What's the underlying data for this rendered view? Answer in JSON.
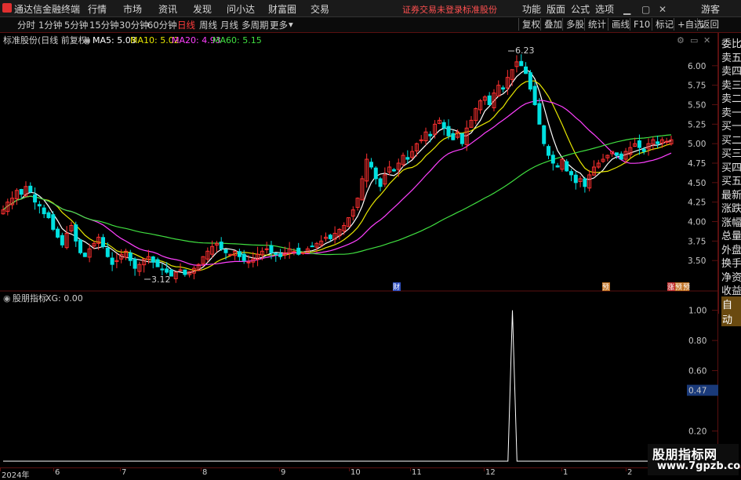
{
  "menubar": {
    "app_title": "通达信金融终端",
    "items": [
      "行情",
      "市场",
      "资讯",
      "发现",
      "问小达",
      "财富圈",
      "交易"
    ],
    "warning": "证券交易未登录",
    "stock_name": "标准股份",
    "right_items": [
      "功能",
      "版面",
      "公式",
      "选项"
    ],
    "user": "游客"
  },
  "toolbar": {
    "timeframes": [
      "分时",
      "1分钟",
      "5分钟",
      "15分钟",
      "30分钟",
      "60分钟",
      "日线",
      "周线",
      "月线",
      "多周期",
      "更多"
    ],
    "active": "日线",
    "right_buttons": [
      "复权",
      "叠加",
      "多股",
      "统计",
      "画线",
      "F10",
      "标记",
      "+自选",
      "返回"
    ]
  },
  "main_chart": {
    "title": "标准股份(日线 前复权)",
    "ma": [
      {
        "label": "MA5: 5.03",
        "color": "#ffffff"
      },
      {
        "label": "MA10: 5.02",
        "color": "#e6e600"
      },
      {
        "label": "MA20: 4.93",
        "color": "#ff40ff"
      },
      {
        "label": "MA60: 5.15",
        "color": "#40e040"
      }
    ],
    "y_ticks": [
      "6.00",
      "5.75",
      "5.50",
      "5.25",
      "5.00",
      "4.75",
      "4.50",
      "4.25",
      "4.00",
      "3.75",
      "3.50"
    ],
    "high_label": "6.23",
    "low_label": "3.12",
    "markers": [
      "财",
      "预",
      "涨",
      "预",
      "预"
    ]
  },
  "right_panel": [
    "委比",
    "卖五",
    "卖四",
    "卖三",
    "卖二",
    "卖一",
    "买一",
    "买二",
    "买三",
    "买四",
    "买五",
    "最新",
    "涨跌",
    "涨幅",
    "总量",
    "外盘",
    "换手",
    "净资",
    "收益",
    "自动"
  ],
  "indicator": {
    "title": "股朋指标",
    "value": "XG: 0.00",
    "y_ticks": [
      "1.00",
      "0.80",
      "0.60",
      "0.47",
      "0.20"
    ]
  },
  "date_axis": [
    "2024年",
    "6",
    "7",
    "8",
    "9",
    "10",
    "11",
    "12",
    "1",
    "2"
  ],
  "watermark": {
    "line1": "股朋指标网",
    "line2": "www.7gpzb.com"
  },
  "colors": {
    "up": "#ff3030",
    "down": "#00e0e0",
    "grid": "#5a1010"
  },
  "chart_data": [
    {
      "type": "candlestick",
      "title": "标准股份(日线 前复权)",
      "ylim": [
        3.2,
        6.3
      ],
      "y_ticks": [
        3.5,
        3.75,
        4.0,
        4.25,
        4.5,
        4.75,
        5.0,
        5.25,
        5.5,
        5.75,
        6.0
      ],
      "annotations": [
        {
          "label": "6.23",
          "value": 6.23
        },
        {
          "label": "3.12",
          "value": 3.12
        }
      ],
      "close": [
        4.15,
        4.25,
        4.3,
        4.4,
        4.35,
        4.45,
        4.38,
        4.25,
        4.2,
        4.1,
        4.05,
        3.9,
        3.8,
        3.7,
        3.85,
        3.95,
        3.75,
        3.6,
        3.55,
        3.65,
        3.72,
        3.8,
        3.68,
        3.55,
        3.45,
        3.5,
        3.58,
        3.62,
        3.5,
        3.4,
        3.45,
        3.52,
        3.55,
        3.48,
        3.42,
        3.38,
        3.35,
        3.3,
        3.35,
        3.38,
        3.32,
        3.36,
        3.4,
        3.45,
        3.55,
        3.62,
        3.68,
        3.72,
        3.65,
        3.6,
        3.58,
        3.62,
        3.55,
        3.5,
        3.48,
        3.52,
        3.58,
        3.62,
        3.65,
        3.6,
        3.58,
        3.55,
        3.6,
        3.65,
        3.62,
        3.58,
        3.6,
        3.65,
        3.68,
        3.72,
        3.75,
        3.8,
        3.78,
        3.85,
        3.9,
        3.95,
        4.05,
        4.15,
        4.3,
        4.55,
        4.8,
        4.7,
        4.55,
        4.45,
        4.6,
        4.7,
        4.65,
        4.75,
        4.85,
        4.8,
        4.9,
        5.0,
        5.05,
        5.15,
        5.1,
        5.25,
        5.3,
        5.2,
        5.1,
        5.05,
        5.15,
        5.0,
        5.2,
        5.3,
        5.45,
        5.55,
        5.6,
        5.5,
        5.65,
        5.75,
        5.7,
        5.85,
        5.95,
        6.05,
        6.0,
        5.9,
        5.7,
        5.5,
        5.25,
        5.0,
        4.85,
        4.75,
        4.7,
        4.8,
        4.65,
        4.6,
        4.5,
        4.55,
        4.45,
        4.6,
        4.7,
        4.75,
        4.8,
        4.85,
        4.9,
        4.85,
        4.8,
        4.9,
        4.95,
        5.0,
        4.95,
        4.9,
        5.0,
        5.05,
        5.0,
        5.05,
        5.03,
        5.05
      ],
      "series": [
        {
          "name": "MA5",
          "value": 5.03,
          "color": "#ffffff"
        },
        {
          "name": "MA10",
          "value": 5.02,
          "color": "#e6e600"
        },
        {
          "name": "MA20",
          "value": 4.93,
          "color": "#ff40ff"
        },
        {
          "name": "MA60",
          "value": 5.15,
          "color": "#40e040"
        }
      ]
    },
    {
      "type": "line",
      "title": "股朋指标",
      "series": [
        {
          "name": "XG",
          "values": [
            0,
            0,
            0,
            0,
            0,
            0,
            0,
            0,
            0,
            0,
            0,
            0,
            0,
            0,
            0,
            0,
            0,
            0,
            0,
            0,
            0,
            0,
            0,
            0,
            0,
            0,
            0,
            0,
            0,
            0,
            0,
            0,
            0,
            0,
            0,
            0,
            0,
            0,
            0,
            0,
            0,
            0,
            0,
            0,
            0,
            0,
            0,
            0,
            0,
            0,
            0,
            0,
            0,
            0,
            0,
            0,
            0,
            0,
            0,
            0,
            0,
            0,
            0,
            0,
            0,
            0,
            0,
            0,
            0,
            0,
            0,
            0,
            0,
            0,
            0,
            0,
            0,
            0,
            0,
            0,
            0,
            0,
            0,
            0,
            0,
            0,
            0,
            0,
            0,
            0,
            0,
            0,
            0,
            0,
            0,
            0,
            0,
            0,
            0,
            0,
            0,
            0,
            0,
            0,
            0,
            0,
            0,
            0,
            0,
            0,
            0,
            0,
            0,
            1,
            0,
            0,
            0,
            0,
            0,
            0,
            0,
            0,
            0,
            0,
            0,
            0,
            0,
            0,
            0,
            0,
            0,
            0,
            0,
            0,
            0,
            0,
            0,
            0,
            0,
            0,
            0,
            0,
            0,
            0,
            0,
            0,
            0,
            0,
            0
          ]
        }
      ],
      "ylim": [
        0,
        1.05
      ],
      "y_ticks": [
        0.2,
        0.47,
        0.6,
        0.8,
        1.0
      ]
    }
  ]
}
